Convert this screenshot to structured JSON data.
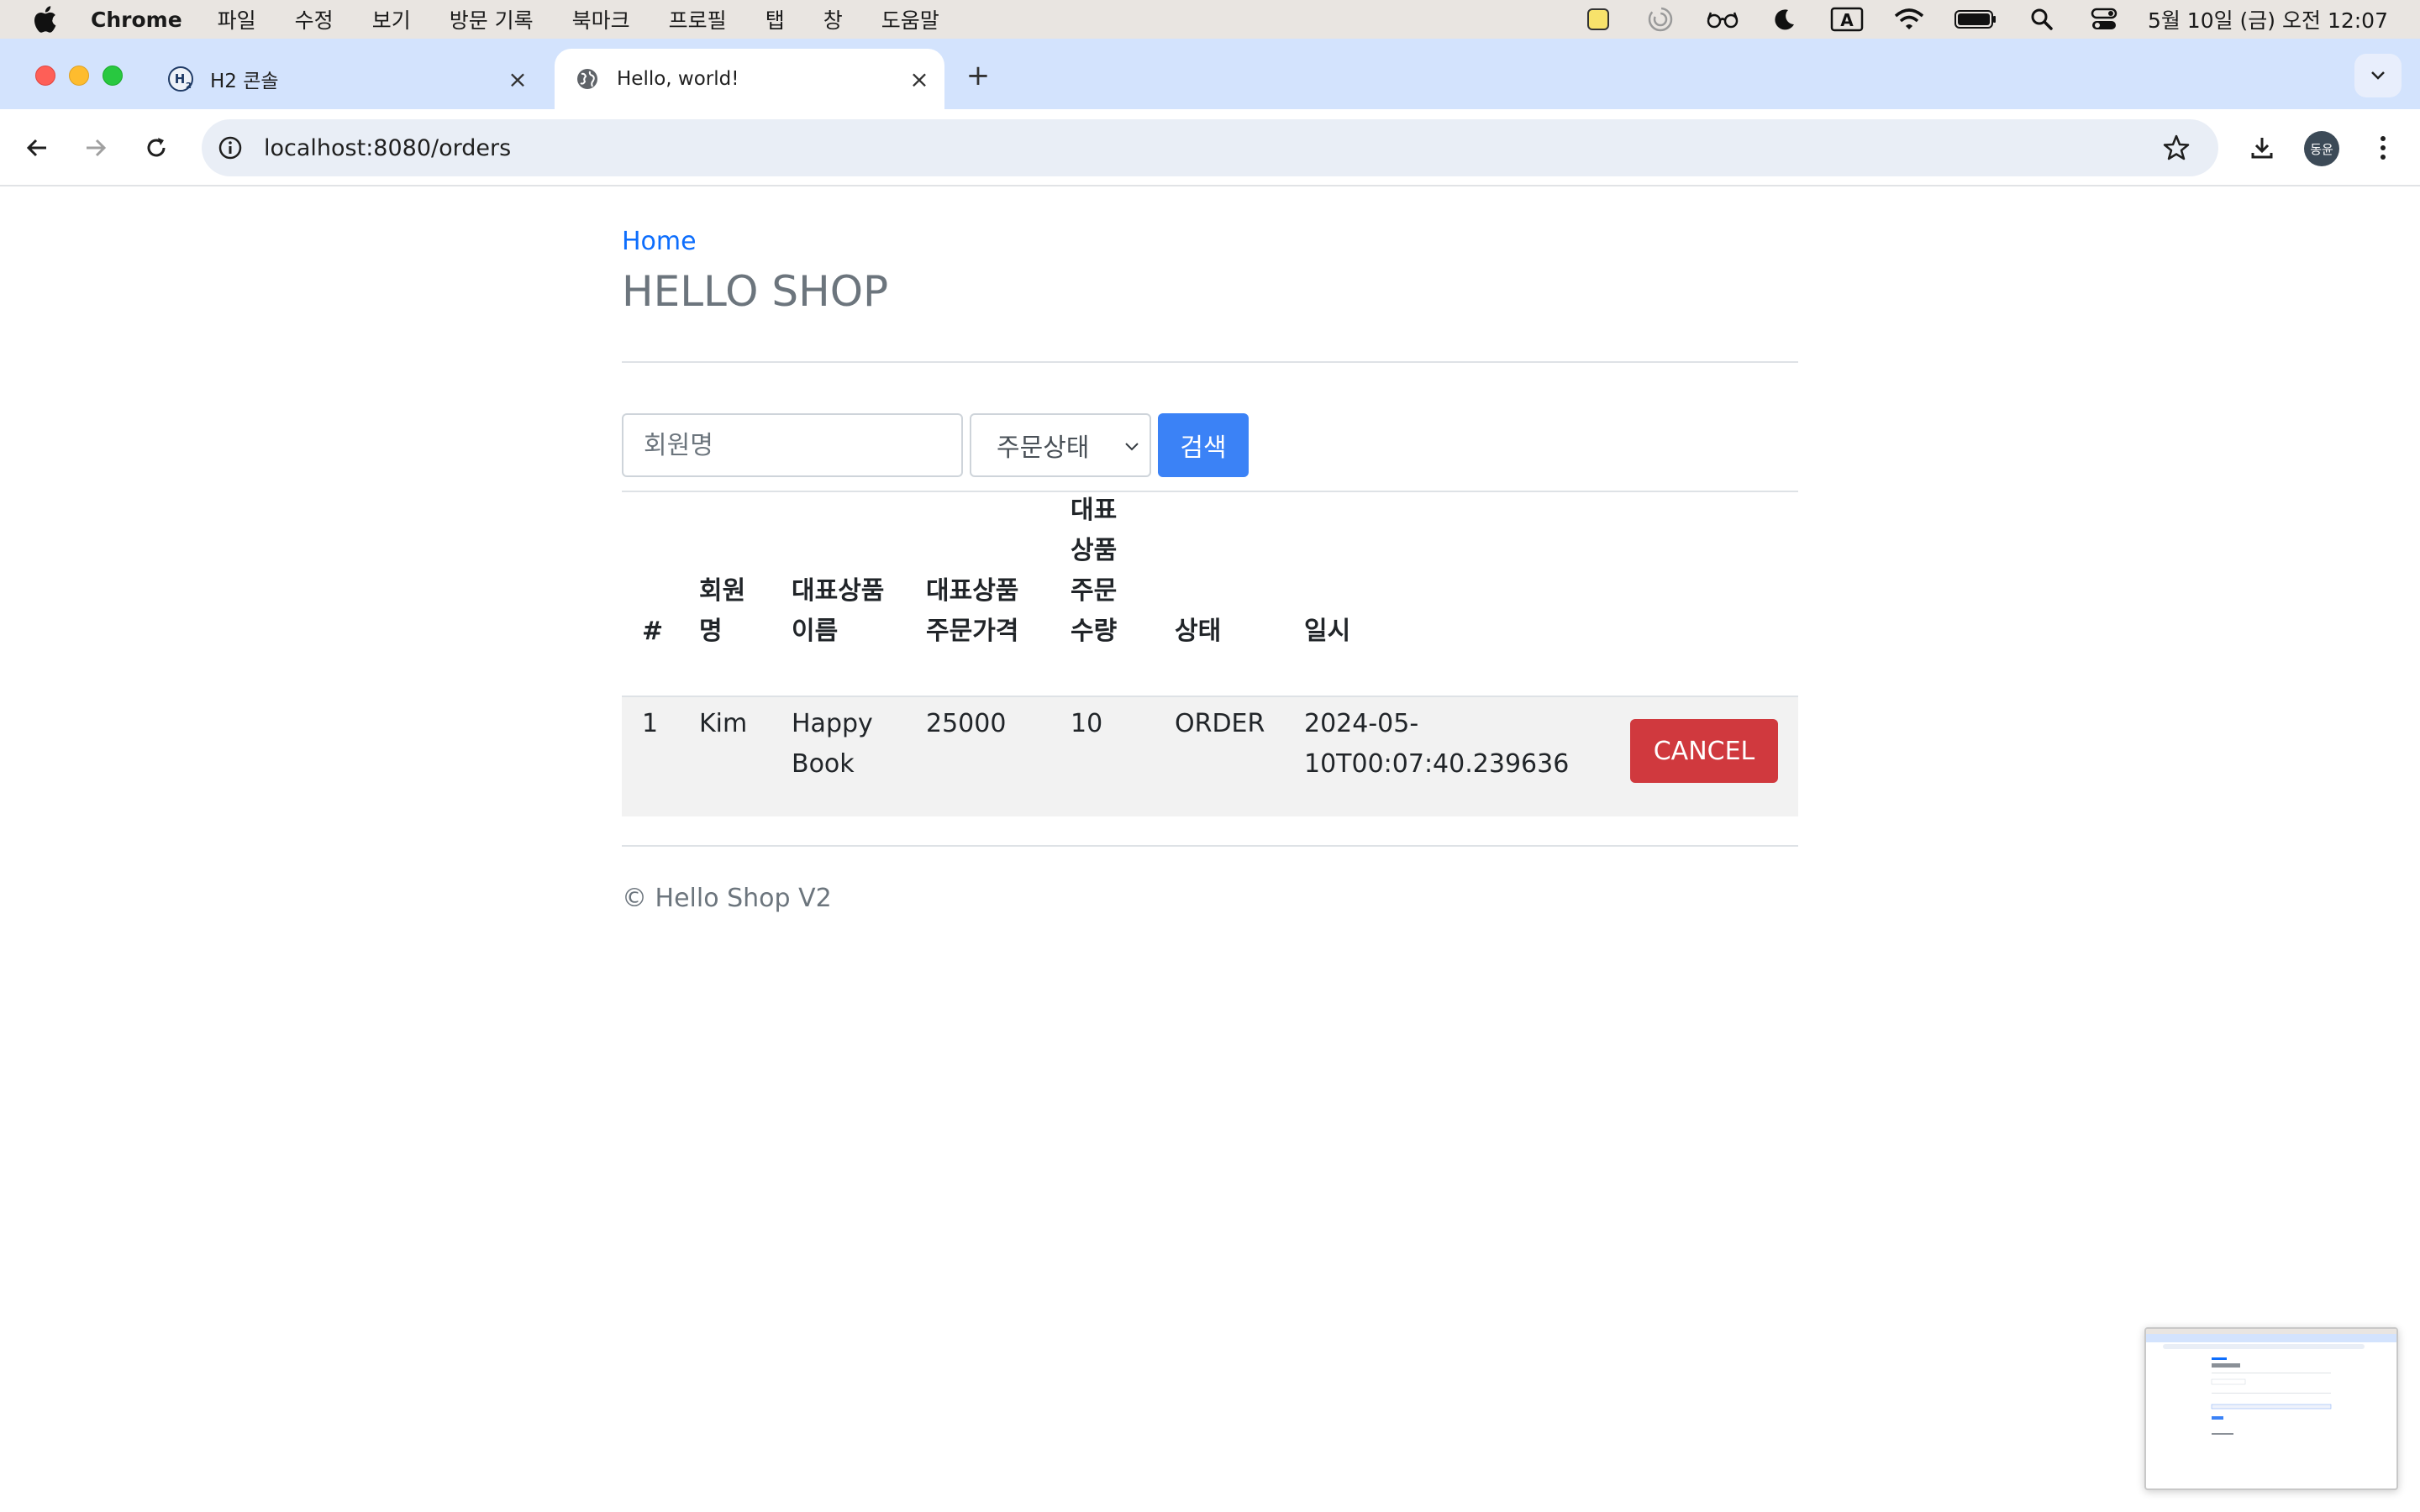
{
  "menubar": {
    "app_name": "Chrome",
    "items": [
      "파일",
      "수정",
      "보기",
      "방문 기록",
      "북마크",
      "프로필",
      "탭",
      "창",
      "도움말"
    ],
    "clock": "5월 10일 (금) 오전 12:07"
  },
  "tabs": [
    {
      "title": "H2 콘솔",
      "active": false
    },
    {
      "title": "Hello, world!",
      "active": true
    }
  ],
  "toolbar": {
    "url": "localhost:8080/orders",
    "avatar_text": "동윤"
  },
  "page": {
    "home_link": "Home",
    "title": "HELLO SHOP",
    "footer": "© Hello Shop V2"
  },
  "search": {
    "member_placeholder": "회원명",
    "status_selected": "주문상태",
    "button_label": "검색"
  },
  "table": {
    "headers": [
      [
        "#"
      ],
      [
        "회원",
        "명"
      ],
      [
        "대표상품",
        "이름"
      ],
      [
        "대표상품",
        "주문가격"
      ],
      [
        "대표",
        "상품",
        "주문",
        "수량"
      ],
      [
        "상태"
      ],
      [
        "일시"
      ]
    ],
    "rows": [
      {
        "id": "1",
        "member": "Kim",
        "item_name": [
          "Happy",
          "Book"
        ],
        "price": "25000",
        "count": "10",
        "status": "ORDER",
        "date": [
          "2024-05-",
          "10T00:07:40.239636"
        ],
        "action_label": "CANCEL"
      }
    ]
  },
  "colors": {
    "link": "#0d6efd",
    "primary_button": "#3b82f6",
    "danger_button": "#d0393e",
    "tabstrip": "#d3e3fd"
  }
}
